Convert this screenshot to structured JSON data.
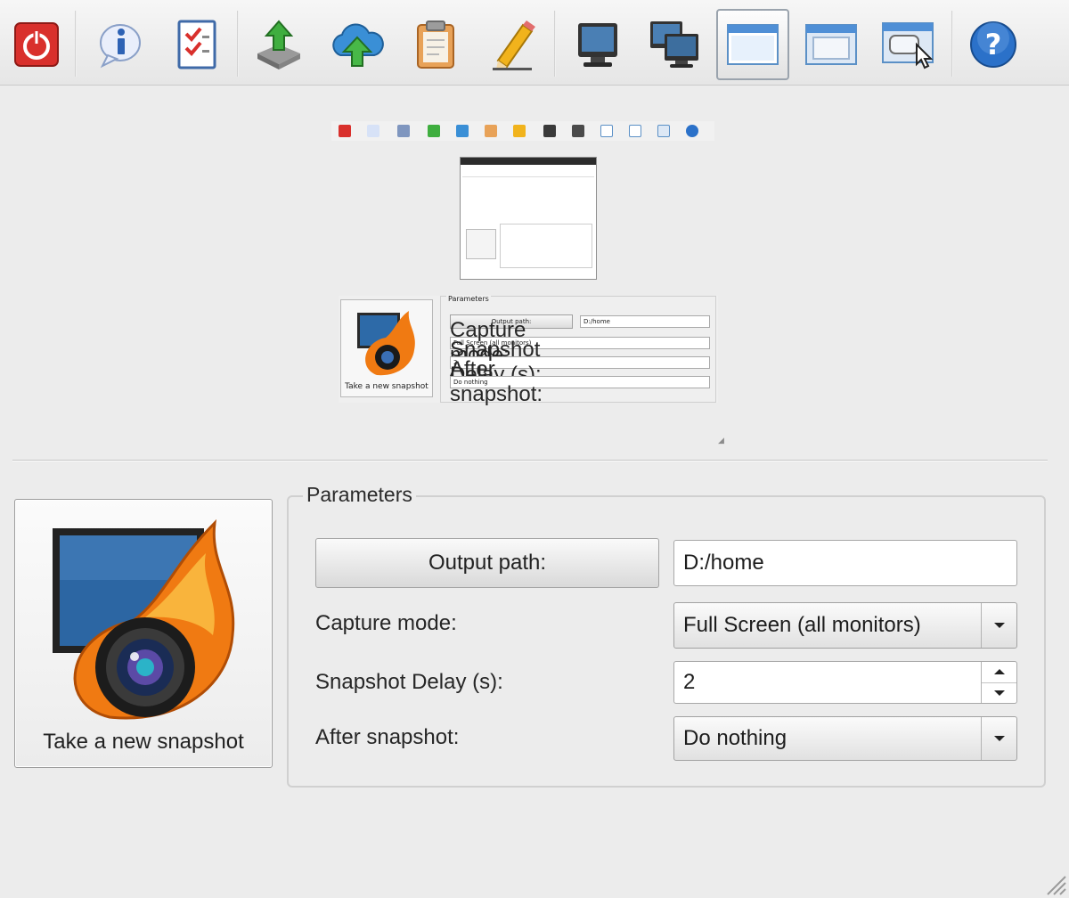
{
  "toolbar": {
    "buttons": [
      {
        "id": "quit",
        "icon": "power-icon"
      },
      {
        "id": "about",
        "icon": "info-icon"
      },
      {
        "id": "tasks",
        "icon": "checklist-icon"
      },
      {
        "id": "save",
        "icon": "save-download-icon"
      },
      {
        "id": "upload",
        "icon": "cloud-upload-icon"
      },
      {
        "id": "copy",
        "icon": "clipboard-icon"
      },
      {
        "id": "edit",
        "icon": "pencil-icon"
      },
      {
        "id": "full-screen",
        "icon": "monitor-icon"
      },
      {
        "id": "all-monitors",
        "icon": "multi-monitor-icon"
      },
      {
        "id": "window",
        "icon": "window-icon",
        "active": true
      },
      {
        "id": "window-region",
        "icon": "window-frame-icon"
      },
      {
        "id": "pick-window",
        "icon": "window-cursor-icon"
      },
      {
        "id": "help",
        "icon": "help-icon"
      }
    ]
  },
  "preview": {
    "mini_output_value": "D:/home",
    "mini_output_label": "Output path:",
    "mini_title": "Parameters",
    "mini_capture_label": "Capture mode:",
    "mini_capture_value": "Full Screen (all monitors)",
    "mini_delay_label": "Snapshot Delay (s):",
    "mini_delay_value": "2",
    "mini_after_label": "After snapshot:",
    "mini_after_value": "Do nothing",
    "mini_snapshot_label": "Take a new snapshot"
  },
  "snapshot_button": {
    "label": "Take a new snapshot"
  },
  "parameters": {
    "title": "Parameters",
    "output_button_label": "Output path:",
    "output_path": "D:/home",
    "capture_label": "Capture mode:",
    "capture_value": "Full Screen (all monitors)",
    "delay_label": "Snapshot Delay (s):",
    "delay_value": "2",
    "after_label": "After snapshot:",
    "after_value": "Do nothing"
  },
  "colors": {
    "quit": "#d9302c",
    "info": "#2d62b5",
    "accent_green": "#3fae3f",
    "flame": "#f07a12",
    "help": "#2b71c9"
  }
}
